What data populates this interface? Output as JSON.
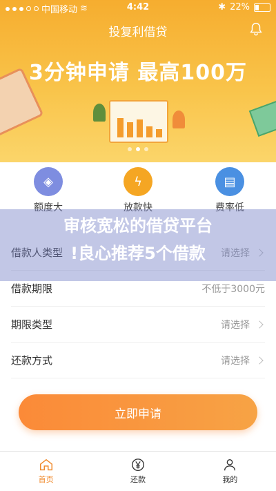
{
  "status_bar": {
    "carrier": "中国移动",
    "time": "4:42",
    "battery": "22%"
  },
  "header": {
    "title": "投复利借贷"
  },
  "banner": {
    "slogan": "3分钟申请  最高100万"
  },
  "features": [
    {
      "label": "额度大",
      "icon": "wallet-icon",
      "color": "#7e8de0"
    },
    {
      "label": "放款快",
      "icon": "lightning-icon",
      "color": "#f5a623"
    },
    {
      "label": "费率低",
      "icon": "id-card-icon",
      "color": "#4a90e2"
    }
  ],
  "overlay": {
    "line1": "审核宽松的借贷平台",
    "line2": "!良心推荐5个借款"
  },
  "form": {
    "rows": [
      {
        "label": "借款人类型",
        "value": "请选择"
      },
      {
        "label": "借款期限",
        "value": "不低于3000元"
      },
      {
        "label": "期限类型",
        "value": "请选择"
      },
      {
        "label": "还款方式",
        "value": "请选择"
      }
    ]
  },
  "actions": {
    "apply": "立即申请"
  },
  "tabs": [
    {
      "label": "首页",
      "icon": "home-icon"
    },
    {
      "label": "还款",
      "icon": "yen-icon"
    },
    {
      "label": "我的",
      "icon": "user-icon"
    }
  ],
  "colors": {
    "accent": "#f08a2c",
    "hero": "#f7b436"
  }
}
